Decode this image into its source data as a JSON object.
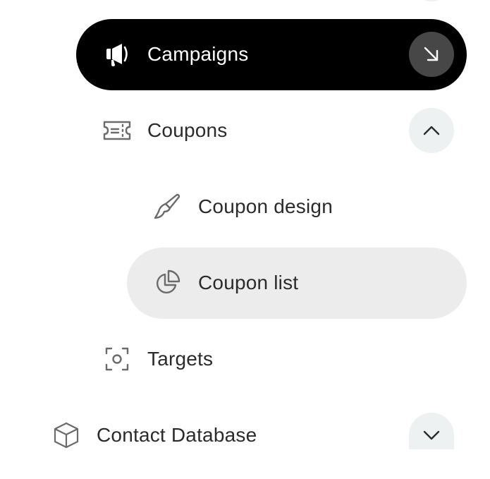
{
  "nav": {
    "campaigns": {
      "label": "Campaigns",
      "icon": "megaphone-icon",
      "action_icon": "arrow-down-right-icon",
      "active": true
    },
    "coupons": {
      "label": "Coupons",
      "icon": "ticket-icon",
      "toggle_icon": "chevron-up-icon",
      "expanded": true
    },
    "coupon_design": {
      "label": "Coupon design",
      "icon": "paintbrush-icon"
    },
    "coupon_list": {
      "label": "Coupon list",
      "icon": "pie-chart-icon",
      "selected": true
    },
    "targets": {
      "label": "Targets",
      "icon": "focus-target-icon"
    },
    "contact_database": {
      "label": "Contact Database",
      "icon": "box-icon",
      "toggle_icon": "chevron-down-icon",
      "expanded": false
    }
  },
  "colors": {
    "active_bg": "#000000",
    "active_btn_bg": "#474747",
    "selected_bg": "#ececec",
    "toggle_bg": "#eef1f1",
    "text": "#2b2b2b",
    "icon": "#6b6b6b"
  }
}
